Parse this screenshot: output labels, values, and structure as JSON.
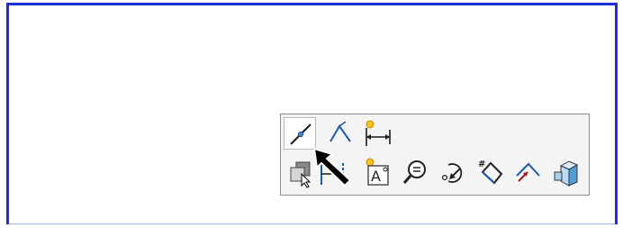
{
  "window": {
    "border_color": "#1a2fd6"
  },
  "toolbar": {
    "row1": [
      {
        "icon": "sketch-line-icon",
        "selected": true
      },
      {
        "icon": "centerline-icon"
      },
      {
        "icon": "smart-dimension-icon"
      }
    ],
    "row2": [
      {
        "icon": "copy-entities-icon"
      },
      {
        "icon": "horizontal-dimension-icon"
      },
      {
        "icon": "note-text-icon"
      },
      {
        "icon": "zoom-to-fit-icon"
      },
      {
        "icon": "rotate-view-icon"
      },
      {
        "icon": "numbered-tag-icon"
      },
      {
        "icon": "angle-line-icon"
      },
      {
        "icon": "3d-box-icon"
      }
    ]
  },
  "cursor": {
    "icon": "pointer-arrow-icon",
    "color": "#000000"
  }
}
